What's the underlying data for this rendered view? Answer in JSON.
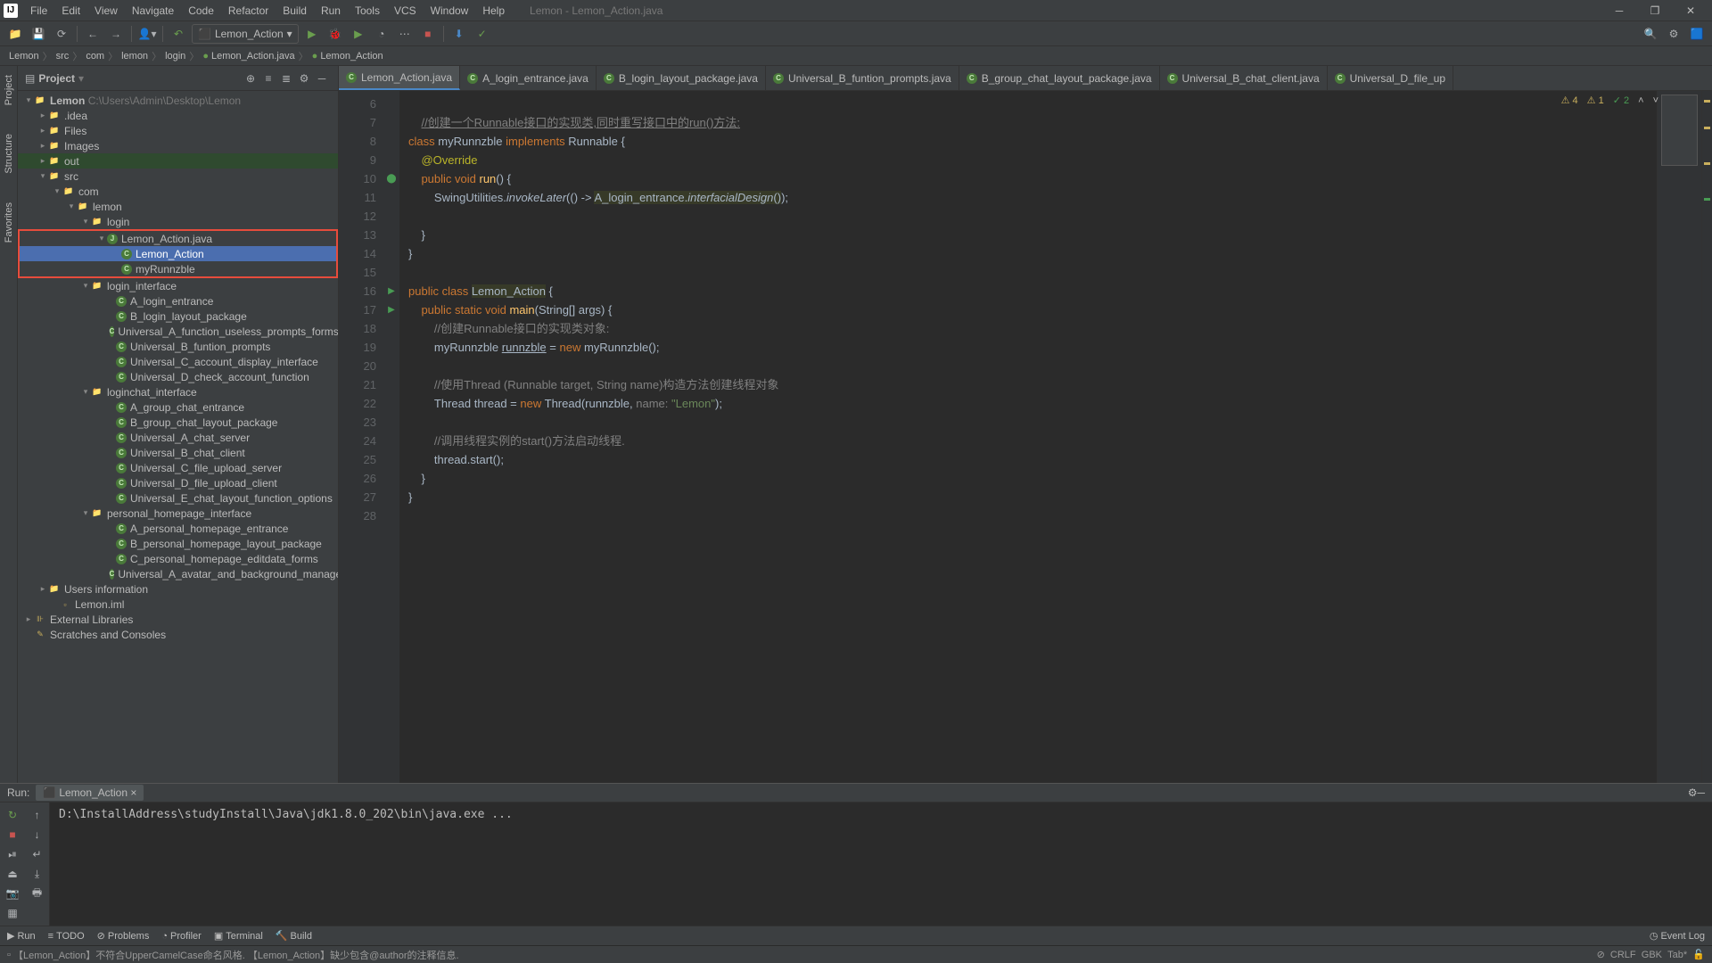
{
  "window": {
    "title": "Lemon - Lemon_Action.java"
  },
  "menu": [
    "File",
    "Edit",
    "View",
    "Navigate",
    "Code",
    "Refactor",
    "Build",
    "Run",
    "Tools",
    "VCS",
    "Window",
    "Help"
  ],
  "toolbar": {
    "run_config": "Lemon_Action"
  },
  "breadcrumb": [
    "Lemon",
    "src",
    "com",
    "lemon",
    "login",
    "Lemon_Action.java",
    "Lemon_Action"
  ],
  "project": {
    "header": "Project",
    "root": {
      "name": "Lemon",
      "path": "C:\\Users\\Admin\\Desktop\\Lemon"
    },
    "nodes": {
      "idea": ".idea",
      "files": "Files",
      "images": "Images",
      "out": "out",
      "src": "src",
      "com": "com",
      "lemon": "lemon",
      "login": "login",
      "la_java": "Lemon_Action.java",
      "la_cls": "Lemon_Action",
      "myr": "myRunnzble",
      "login_if": "login_interface",
      "a_login": "A_login_entrance",
      "b_login": "B_login_layout_package",
      "ua_func": "Universal_A_function_useless_prompts_forms",
      "ub_func": "Universal_B_funtion_prompts",
      "uc_acct": "Universal_C_account_display_interface",
      "ud_chk": "Universal_D_check_account_function",
      "chat_if": "loginchat_interface",
      "a_chat": "A_group_chat_entrance",
      "b_chat": "B_group_chat_layout_package",
      "ua_chat": "Universal_A_chat_server",
      "ub_chat": "Universal_B_chat_client",
      "uc_file": "Universal_C_file_upload_server",
      "ud_file": "Universal_D_file_upload_client",
      "ue_chat": "Universal_E_chat_layout_function_options",
      "pers_if": "personal_homepage_interface",
      "a_pers": "A_personal_homepage_entrance",
      "b_pers": "B_personal_homepage_layout_package",
      "c_pers": "C_personal_homepage_editdata_forms",
      "ua_av": "Universal_A_avatar_and_background_manage",
      "users": "Users information",
      "iml": "Lemon.iml",
      "ext": "External Libraries",
      "scr": "Scratches and Consoles"
    }
  },
  "tabs": [
    {
      "label": "Lemon_Action.java",
      "active": true
    },
    {
      "label": "A_login_entrance.java"
    },
    {
      "label": "B_login_layout_package.java"
    },
    {
      "label": "Universal_B_funtion_prompts.java"
    },
    {
      "label": "B_group_chat_layout_package.java"
    },
    {
      "label": "Universal_B_chat_client.java"
    },
    {
      "label": "Universal_D_file_up"
    }
  ],
  "inspections": {
    "w1": "4",
    "w2": "1",
    "ok": "2"
  },
  "code": {
    "l7_cmt": "//创建一个Runnable接口的实现类,同时重写接口中的run()方法:",
    "l8_a": "class ",
    "l8_b": "myRunnzble ",
    "l8_c": "implements ",
    "l8_d": "Runnable {",
    "l9": "@Override",
    "l10_a": "public void ",
    "l10_b": "run",
    "l10_c": "() {",
    "l11_a": "SwingUtilities.",
    "l11_b": "invokeLater",
    "l11_c": "(() -> ",
    "l11_d": "A_login_entrance.",
    "l11_e": "interfacialDesign",
    "l11_f": "()",
    "l11_g": ");",
    "l13": "}",
    "l14": "}",
    "l16_a": "public class ",
    "l16_b": "Lemon_Action",
    "l16_c": " {",
    "l17_a": "public static void ",
    "l17_b": "main",
    "l17_c": "(String[] args) {",
    "l18": "//创建Runnable接口的实现类对象:",
    "l19_a": "myRunnzble ",
    "l19_b": "runnzble",
    "l19_c": " = ",
    "l19_d": "new ",
    "l19_e": "myRunnzble();",
    "l21": "//使用Thread (Runnable target, String name)构造方法创建线程对象",
    "l22_a": "Thread thread = ",
    "l22_b": "new ",
    "l22_c": "Thread(runnzble,  ",
    "l22_d": "name: ",
    "l22_e": "\"Lemon\"",
    "l22_f": ");",
    "l24": "//调用线程实例的start()方法启动线程.",
    "l25": "thread.start();",
    "l26": "}",
    "l27": "}"
  },
  "gutter_lines": [
    "6",
    "7",
    "8",
    "9",
    "10",
    "11",
    "12",
    "13",
    "14",
    "15",
    "16",
    "17",
    "18",
    "19",
    "20",
    "21",
    "22",
    "23",
    "24",
    "25",
    "26",
    "27",
    "28"
  ],
  "run": {
    "label": "Run:",
    "tab": "Lemon_Action",
    "output": "D:\\InstallAddress\\studyInstall\\Java\\jdk1.8.0_202\\bin\\java.exe ..."
  },
  "bottombar": {
    "run": "Run",
    "todo": "TODO",
    "problems": "Problems",
    "profiler": "Profiler",
    "terminal": "Terminal",
    "build": "Build",
    "eventlog": "Event Log"
  },
  "status": {
    "msg": "【Lemon_Action】不符合UpperCamelCase命名风格. 【Lemon_Action】缺少包含@author的注释信息.",
    "crlf": "CRLF",
    "enc": "GBK",
    "indent": "Tab*"
  },
  "leftlabels": {
    "project": "Project",
    "structure": "Structure",
    "favorites": "Favorites"
  }
}
